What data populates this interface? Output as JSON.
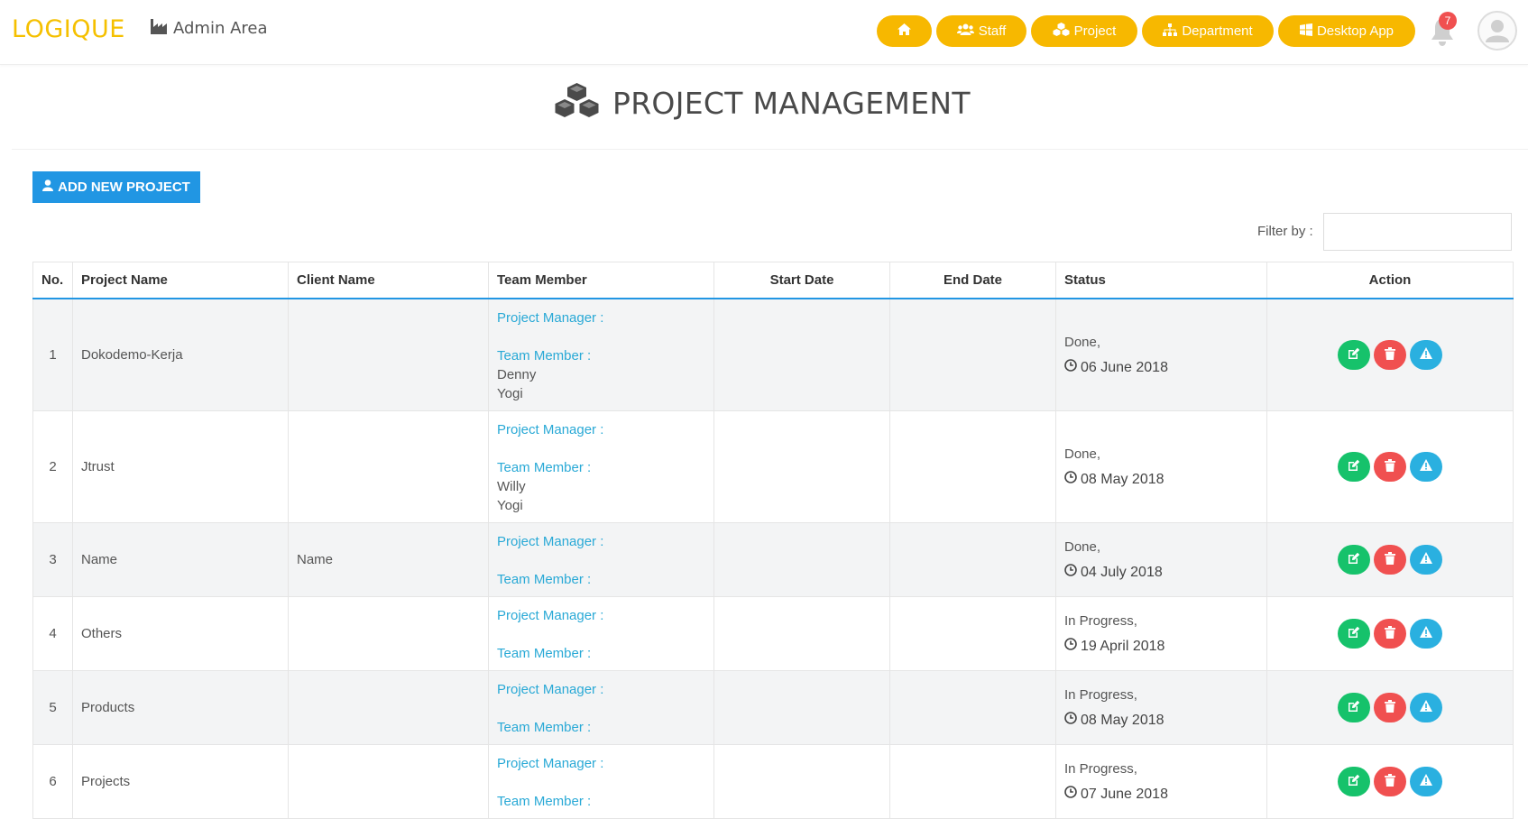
{
  "brand": "LOGIQUE",
  "admin_area": "Admin Area",
  "nav": {
    "staff": "Staff",
    "project": "Project",
    "department": "Department",
    "desktop_app": "Desktop App"
  },
  "notifications_count": "7",
  "page_title": "PROJECT MANAGEMENT",
  "add_button": "ADD NEW PROJECT",
  "filter_label": "Filter by :",
  "filter_value": "",
  "table": {
    "headers": [
      "No.",
      "Project Name",
      "Client Name",
      "Team Member",
      "Start Date",
      "End Date",
      "Status",
      "Action"
    ],
    "pm_label": "Project Manager :",
    "tm_label": "Team Member :",
    "rows": [
      {
        "no": "1",
        "project": "Dokodemo-Kerja",
        "client": "",
        "members": [
          "Denny",
          "Yogi"
        ],
        "start": "",
        "end": "",
        "status": "Done,",
        "date": "06 June 2018"
      },
      {
        "no": "2",
        "project": "Jtrust",
        "client": "",
        "members": [
          "Willy",
          "Yogi"
        ],
        "start": "",
        "end": "",
        "status": "Done,",
        "date": "08 May 2018"
      },
      {
        "no": "3",
        "project": "Name",
        "client": "Name",
        "members": [],
        "start": "",
        "end": "",
        "status": "Done,",
        "date": "04 July 2018"
      },
      {
        "no": "4",
        "project": "Others",
        "client": "",
        "members": [],
        "start": "",
        "end": "",
        "status": "In Progress,",
        "date": "19 April 2018"
      },
      {
        "no": "5",
        "project": "Products",
        "client": "",
        "members": [],
        "start": "",
        "end": "",
        "status": "In Progress,",
        "date": "08 May 2018"
      },
      {
        "no": "6",
        "project": "Projects",
        "client": "",
        "members": [],
        "start": "",
        "end": "",
        "status": "In Progress,",
        "date": "07 June 2018"
      }
    ]
  },
  "colors": {
    "brand": "#f5c000",
    "nav_button": "#f7b800",
    "primary": "#2196e3",
    "link": "#29a9d6",
    "edit": "#16c26b",
    "delete": "#f05050",
    "warning": "#2ab0e0"
  }
}
